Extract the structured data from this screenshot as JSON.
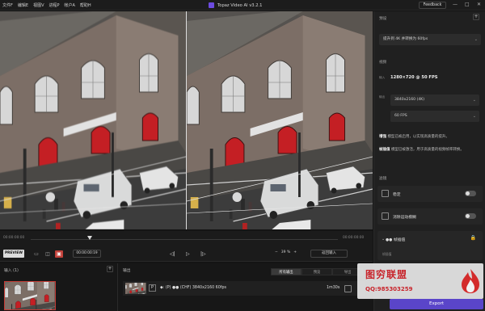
{
  "titlebar": {
    "menu": [
      "文件F",
      "编辑E",
      "视图V",
      "进程P",
      "帐户A",
      "帮助H"
    ],
    "app_title": "Topaz Video AI v3.2.1",
    "feedback": "Feedback",
    "minimize": "—",
    "maximize": "□",
    "close": "✕"
  },
  "timeline": {
    "start": "00:00:00:00",
    "end": "00:00:00:00"
  },
  "controls": {
    "preview_label": "PREVIEW",
    "timecode": "00:00:00:19",
    "prev_frame": "◁|",
    "play": "▷",
    "next_frame": "|▷",
    "zoom_value": "39 %",
    "zoom_minus": "−",
    "zoom_plus": "+",
    "return_label": "返回输入"
  },
  "io": {
    "input_heading": "输入 (1)",
    "output_heading": "输出",
    "tabs": [
      "所有输出",
      "预览",
      "导出"
    ],
    "output_tag": "P",
    "output_text": "◆: (P) ●● (CHF) 3840x2160 60fps",
    "output_duration": "1m30s"
  },
  "panel": {
    "preset_heading": "预设",
    "preset_value": "提升到 4K 并转换为 60fps",
    "video_heading": "视频",
    "input_tag": "输入",
    "input_info": "1280×720 @ 50 FPS",
    "output_tag": "输出",
    "resolution_value": "3840x2160 (4K)",
    "fps_value": "60 FPS",
    "desc_enhance_label": "增强",
    "desc_enhance": "模型已被启用，以实现高质量的提升。",
    "desc_interp_label": "帧插值",
    "desc_interp": "模型已被激活，用于高质量的视频帧率转换。",
    "filters_heading": "滤镜",
    "feature_stabilize": "稳定",
    "feature_motion_blur": "消除运动模糊",
    "feature_interpolation": "●● 帧插值",
    "sub_label": "帧插值",
    "export_label": "Export"
  },
  "watermark": {
    "title": "图穷联盟",
    "qq": "QQ:985303259"
  }
}
